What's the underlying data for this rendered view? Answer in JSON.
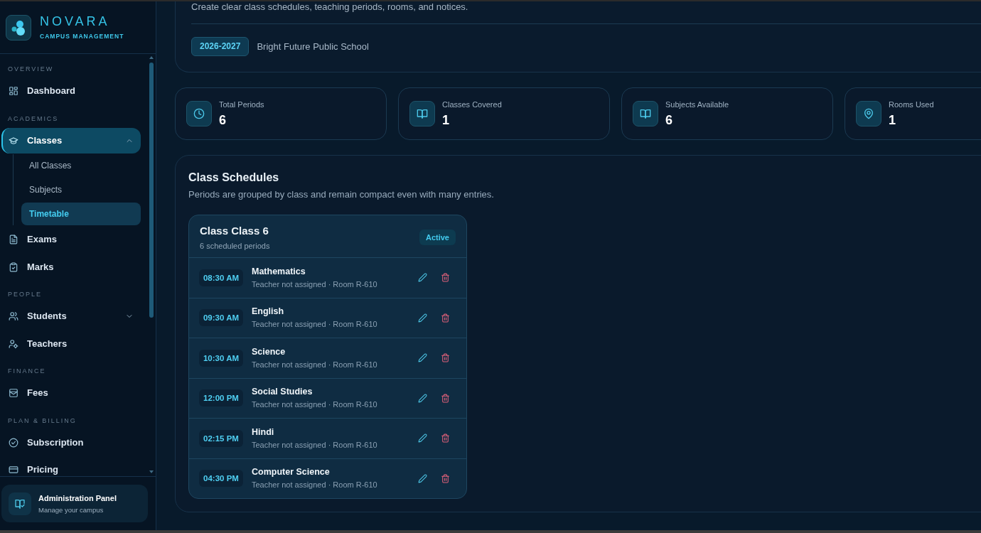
{
  "brand": {
    "name": "NOVARA",
    "tagline": "CAMPUS MANAGEMENT"
  },
  "sidebar": {
    "sections": [
      {
        "heading": "OVERVIEW",
        "items": [
          {
            "kind": "link",
            "label": "Dashboard",
            "selected": false
          }
        ]
      },
      {
        "heading": "ACADEMICS",
        "items": [
          {
            "kind": "group",
            "label": "Classes",
            "selected": true,
            "expanded": true,
            "children": [
              {
                "label": "All Classes",
                "selected": false
              },
              {
                "label": "Subjects",
                "selected": false
              },
              {
                "label": "Timetable",
                "selected": true
              }
            ]
          },
          {
            "kind": "link",
            "label": "Exams",
            "selected": false
          },
          {
            "kind": "link",
            "label": "Marks",
            "selected": false
          }
        ]
      },
      {
        "heading": "PEOPLE",
        "items": [
          {
            "kind": "group",
            "label": "Students",
            "selected": false,
            "expanded": false
          },
          {
            "kind": "link",
            "label": "Teachers",
            "selected": false
          }
        ]
      },
      {
        "heading": "FINANCE",
        "items": [
          {
            "kind": "link",
            "label": "Fees",
            "selected": false
          }
        ]
      },
      {
        "heading": "PLAN & BILLING",
        "items": [
          {
            "kind": "link",
            "label": "Subscription",
            "selected": false
          },
          {
            "kind": "link",
            "label": "Pricing",
            "selected": false
          }
        ]
      }
    ],
    "footer": {
      "title": "Administration Panel",
      "subtitle": "Manage your campus"
    }
  },
  "header": {
    "description": "Create clear class schedules, teaching periods, rooms, and notices.",
    "year": "2026-2027",
    "school": "Bright Future Public School"
  },
  "stats": [
    {
      "label": "Total Periods",
      "value": "6"
    },
    {
      "label": "Classes Covered",
      "value": "1"
    },
    {
      "label": "Subjects Available",
      "value": "6"
    },
    {
      "label": "Rooms Used",
      "value": "1"
    }
  ],
  "schedules": {
    "title": "Class Schedules",
    "subtitle": "Periods are grouped by class and remain compact even with many entries.",
    "classes": [
      {
        "title": "Class Class 6",
        "count": "6 scheduled periods",
        "status": "Active",
        "periods": [
          {
            "time": "08:30 AM",
            "subject": "Mathematics",
            "details": "Teacher not assigned · Room R-610"
          },
          {
            "time": "09:30 AM",
            "subject": "English",
            "details": "Teacher not assigned · Room R-610"
          },
          {
            "time": "10:30 AM",
            "subject": "Science",
            "details": "Teacher not assigned · Room R-610"
          },
          {
            "time": "12:00 PM",
            "subject": "Social Studies",
            "details": "Teacher not assigned · Room R-610"
          },
          {
            "time": "02:15 PM",
            "subject": "Hindi",
            "details": "Teacher not assigned · Room R-610"
          },
          {
            "time": "04:30 PM",
            "subject": "Computer Science",
            "details": "Teacher not assigned · Room R-610"
          }
        ]
      }
    ]
  }
}
